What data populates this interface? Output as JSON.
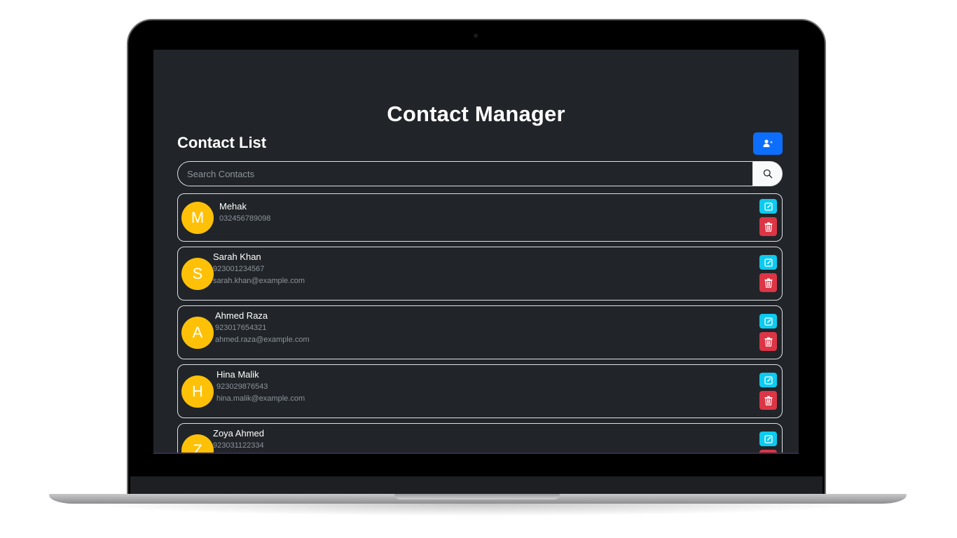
{
  "app": {
    "title": "Contact Manager",
    "list_title": "Contact List"
  },
  "search": {
    "placeholder": "Search Contacts"
  },
  "icons": {
    "add": "add-user-icon",
    "search": "search-icon",
    "edit": "edit-icon",
    "delete": "trash-icon"
  },
  "colors": {
    "background": "#212529",
    "primary": "#0d6efd",
    "info": "#0dcaf0",
    "danger": "#dc3545",
    "avatar": "#ffc107"
  },
  "contacts": [
    {
      "initial": "M",
      "name": "Mehak",
      "phone": "032456789098",
      "email": ""
    },
    {
      "initial": "S",
      "name": "Sarah Khan",
      "phone": "923001234567",
      "email": "sarah.khan@example.com"
    },
    {
      "initial": "A",
      "name": "Ahmed Raza",
      "phone": "923017654321",
      "email": "ahmed.raza@example.com"
    },
    {
      "initial": "H",
      "name": "Hina Malik",
      "phone": "923029876543",
      "email": "hina.malik@example.com"
    },
    {
      "initial": "Z",
      "name": "Zoya Ahmed",
      "phone": "923031122334",
      "email": ""
    }
  ]
}
